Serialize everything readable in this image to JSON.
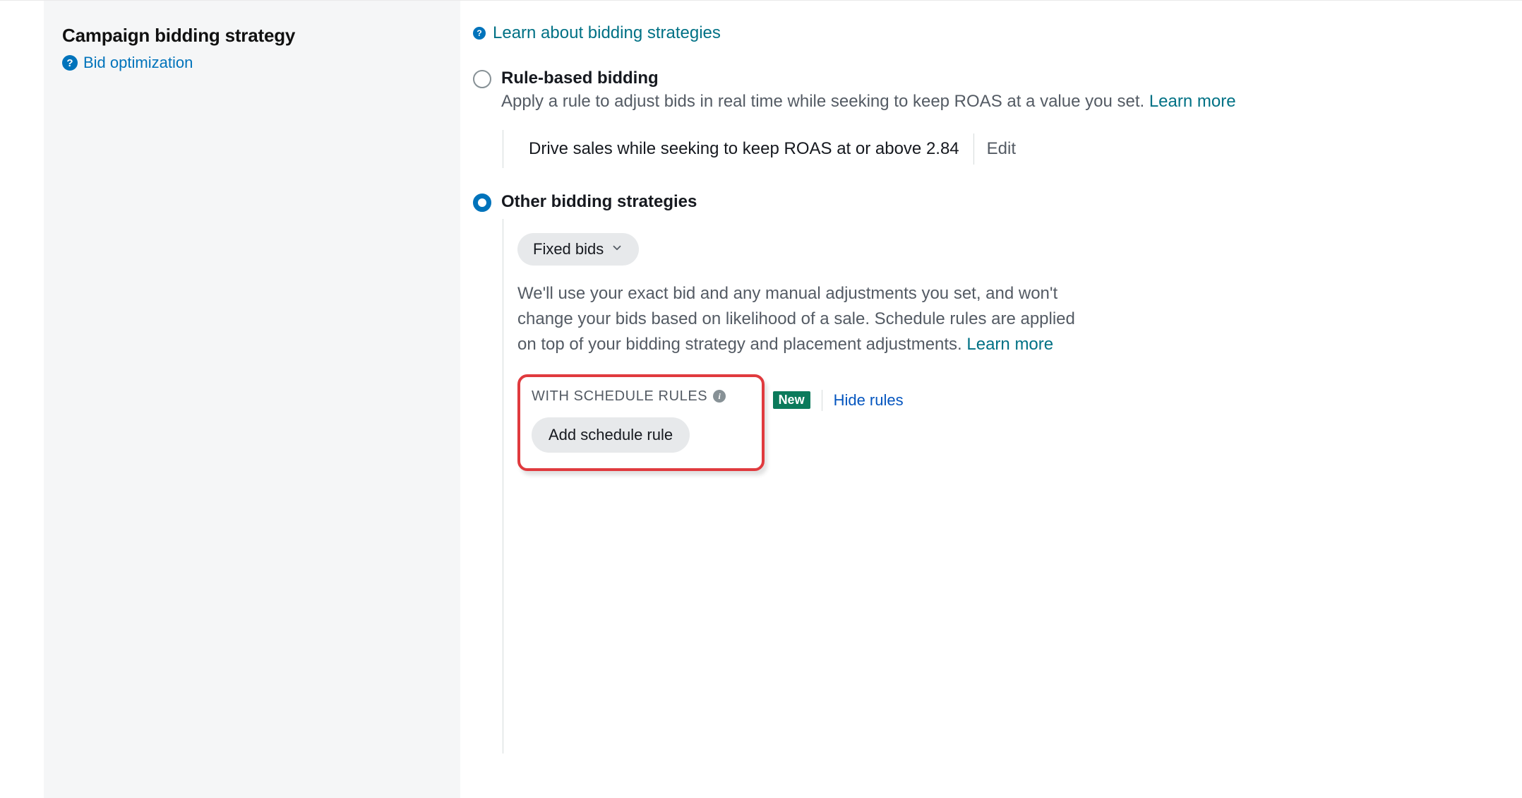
{
  "sidebar": {
    "title": "Campaign bidding strategy",
    "help_link": "Bid optimization"
  },
  "main": {
    "learn_link": "Learn about bidding strategies",
    "options": {
      "rule_based": {
        "title": "Rule-based bidding",
        "desc": "Apply a rule to adjust bids in real time while seeking to keep ROAS at a value you set. ",
        "learn_more": "Learn more",
        "summary": "Drive sales while seeking to keep ROAS at or above 2.84",
        "edit": "Edit"
      },
      "other": {
        "title": "Other bidding strategies",
        "select_label": "Fixed bids",
        "body": "We'll use your exact bid and any manual adjustments you set, and won't change your bids based on likelihood of a sale. Schedule rules are applied on top of your bidding strategy and placement adjustments. ",
        "learn_more": "Learn more",
        "schedule": {
          "label": "WITH SCHEDULE RULES",
          "badge": "New",
          "hide": "Hide rules",
          "button": "Add schedule rule"
        }
      }
    }
  }
}
